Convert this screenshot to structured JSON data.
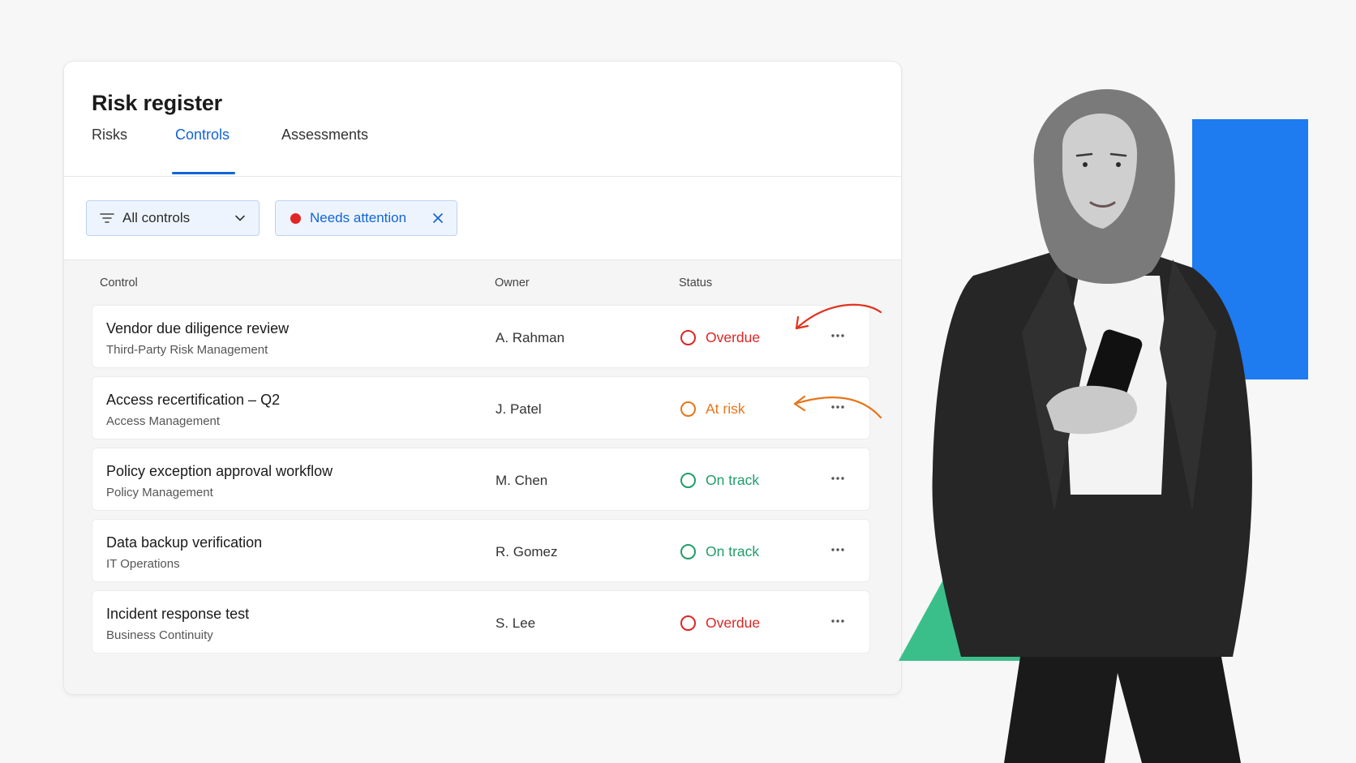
{
  "page": {
    "title": "Risk register"
  },
  "tabs": [
    {
      "label": "Risks",
      "active": false
    },
    {
      "label": "Controls",
      "active": true
    },
    {
      "label": "Assessments",
      "active": false
    }
  ],
  "filters": {
    "all_controls": {
      "label": "All controls",
      "icon": "filter-icon"
    },
    "needs_attention": {
      "label": "Needs attention",
      "icon": "red-dot",
      "removable": true
    }
  },
  "table": {
    "headers": {
      "control": "Control",
      "owner": "Owner",
      "status": "Status"
    },
    "rows": [
      {
        "control": "Vendor due diligence review",
        "category": "Third-Party Risk Management",
        "owner": "A. Rahman",
        "status": "Overdue"
      },
      {
        "control": "Access recertification – Q2",
        "category": "Access Management",
        "owner": "J. Patel",
        "status": "At risk"
      },
      {
        "control": "Policy exception approval workflow",
        "category": "Policy Management",
        "owner": "M. Chen",
        "status": "On track"
      },
      {
        "control": "Data backup verification",
        "category": "IT Operations",
        "owner": "R. Gomez",
        "status": "On track"
      },
      {
        "control": "Incident response test",
        "category": "Business Continuity",
        "owner": "S. Lee",
        "status": "Overdue"
      }
    ]
  },
  "colors": {
    "accent": "#1264d6",
    "overdue": "#dc2626",
    "at_risk": "#e8751a",
    "on_track": "#1f9d6a",
    "decor_blue": "#1e7bf0",
    "decor_green": "#3bbf8a"
  }
}
